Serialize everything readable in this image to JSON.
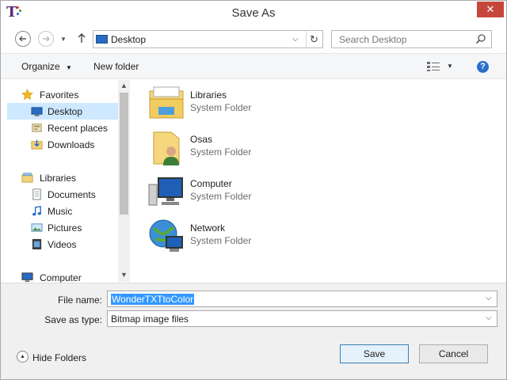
{
  "window": {
    "title": "Save As",
    "close_symbol": "✕"
  },
  "nav": {
    "back_icon": "back-arrow-icon",
    "forward_icon": "forward-arrow-icon",
    "address": "Desktop",
    "search_placeholder": "Search Desktop"
  },
  "toolbar": {
    "organize_label": "Organize",
    "new_folder_label": "New folder"
  },
  "sidebar": {
    "favorites": "Favorites",
    "desktop": "Desktop",
    "recent": "Recent places",
    "downloads": "Downloads",
    "libraries": "Libraries",
    "documents": "Documents",
    "music": "Music",
    "pictures": "Pictures",
    "videos": "Videos",
    "computer": "Computer"
  },
  "items": [
    {
      "name": "Libraries",
      "type": "System Folder",
      "icon": "libraries-icon"
    },
    {
      "name": "Osas",
      "type": "System Folder",
      "icon": "user-folder-icon"
    },
    {
      "name": "Computer",
      "type": "System Folder",
      "icon": "computer-icon"
    },
    {
      "name": "Network",
      "type": "System Folder",
      "icon": "network-icon"
    }
  ],
  "form": {
    "file_name_label": "File name:",
    "file_name_value": "WonderTXTtoColor",
    "save_type_label": "Save as type:",
    "save_type_value": "Bitmap image files"
  },
  "footer": {
    "hide_folders": "Hide Folders",
    "save": "Save",
    "cancel": "Cancel"
  },
  "colors": {
    "accent": "#3399ff",
    "selected_nav": "#cde8ff",
    "close": "#c7463c"
  }
}
